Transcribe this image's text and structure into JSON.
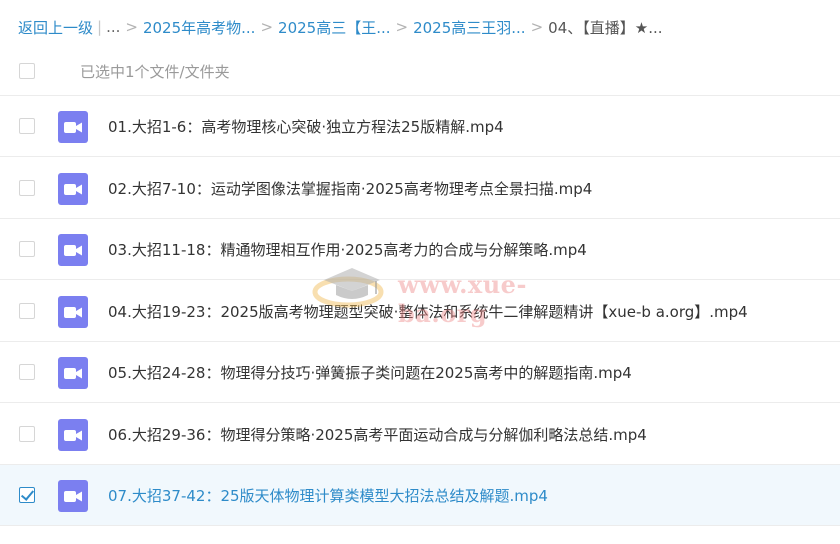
{
  "breadcrumb": {
    "back": "返回上一级",
    "ellipsis": "...",
    "items": [
      "2025年高考物...",
      "2025高三【王...",
      "2025高三王羽..."
    ],
    "current": "04、【直播】★..."
  },
  "selection": {
    "text": "已选中1个文件/文件夹"
  },
  "files": [
    {
      "name": "01.大招1-6：高考物理核心突破·独立方程法25版精解.mp4",
      "checked": false
    },
    {
      "name": "02.大招7-10：运动学图像法掌握指南·2025高考物理考点全景扫描.mp4",
      "checked": false
    },
    {
      "name": "03.大招11-18：精通物理相互作用·2025高考力的合成与分解策略.mp4",
      "checked": false
    },
    {
      "name": "04.大招19-23：2025版高考物理题型突破·整体法和系统牛二律解题精讲【xue-b a.org】.mp4",
      "checked": false
    },
    {
      "name": "05.大招24-28：物理得分技巧·弹簧振子类问题在2025高考中的解题指南.mp4",
      "checked": false
    },
    {
      "name": "06.大招29-36：物理得分策略·2025高考平面运动合成与分解伽利略法总结.mp4",
      "checked": false
    },
    {
      "name": "07.大招37-42：25版天体物理计算类模型大招法总结及解题.mp4",
      "checked": true
    }
  ],
  "watermark": {
    "text": "www.xue-ba.org",
    "icon": "graduation-cap-icon"
  },
  "colors": {
    "link": "#2e8bc9",
    "video_icon": "#7b7ff0",
    "selected_row": "#f1f8fd",
    "watermark": "#eb8282"
  }
}
